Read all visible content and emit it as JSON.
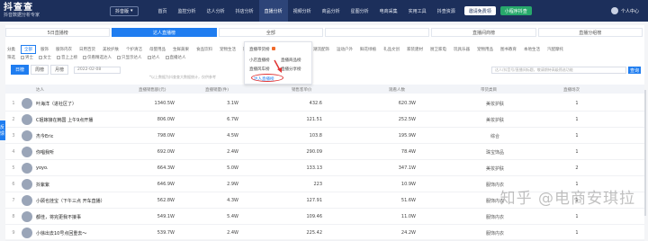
{
  "topbar": {
    "logo_main": "抖查查",
    "logo_sub": "抖音数据分析专家",
    "platform": "抖音版",
    "nav": [
      "首页",
      "监控分析",
      "达人分析",
      "抖店分析",
      "直播分析",
      "视频分析",
      "商品分析",
      "星图分析",
      "电商采集",
      "实用工具",
      "抖查资源"
    ],
    "vip_btn": "邀请免费领",
    "app_btn": "小程序抖查",
    "user": "个人中心"
  },
  "tabs": [
    "5日直播榜",
    "达人直播榜",
    "全部",
    "",
    "直播间商榜",
    "直播分组榜"
  ],
  "categories": {
    "label": "分类",
    "items": [
      "全部",
      "服饰",
      "服饰内衣",
      "日用百货",
      "美妆护肤",
      "个护清洁",
      "母婴用品",
      "生鲜蔬果",
      "食品饮料",
      "宠物生活",
      "影音娱乐",
      "智能家居",
      "家纺家具",
      "潮流配饰",
      "运动户外",
      "鲜花绿植",
      "礼品文创",
      "家装建材",
      "厨卫家电",
      "玩具乐器",
      "宠物用品",
      "图书教育",
      "本地生活",
      "汽配摩托"
    ]
  },
  "filters": {
    "label": "筛选",
    "items": [
      "男士",
      "女士",
      "音上上榜",
      "仅看精选达人",
      "只显示达人",
      "达人",
      "直播达人"
    ]
  },
  "date": {
    "segments": [
      "日榜",
      "周榜",
      "月榜"
    ],
    "value": "2022-02-08"
  },
  "search": {
    "placeholder": "达人/抖音号/直播间标题，敬请期待高级筛选功能",
    "btn": "查询"
  },
  "note": "*以上数据为抖查查大数据统计，仅供参考",
  "headers": [
    "达人",
    "直播销售额(元)",
    "直播销量(件)",
    "销售客单价",
    "观看人数",
    "带货类目",
    "直播场次"
  ],
  "rows": [
    {
      "rank": "1",
      "name": "叶海洋（进社区了）",
      "sales": "1340.5W",
      "volume": "3.1W",
      "price": "432.6",
      "views": "620.3W",
      "category": "美妆护肤",
      "count": "1"
    },
    {
      "rank": "2",
      "name": "C姐嫁接在韩国 上午9点开播",
      "sales": "806.0W",
      "volume": "6.7W",
      "price": "121.51",
      "views": "252.5W",
      "category": "美妆护肤",
      "count": "1"
    },
    {
      "rank": "3",
      "name": "杰今Eric",
      "sales": "798.0W",
      "volume": "4.5W",
      "price": "103.8",
      "views": "195.9W",
      "category": "综合",
      "count": "1"
    },
    {
      "rank": "4",
      "name": "你唱我听",
      "sales": "692.0W",
      "volume": "2.4W",
      "price": "290.09",
      "views": "78.4W",
      "category": "珠宝饰品",
      "count": "1"
    },
    {
      "rank": "5",
      "name": "yoyo.",
      "sales": "664.3W",
      "volume": "5.0W",
      "price": "133.13",
      "views": "347.1W",
      "category": "美妆护肤",
      "count": "2"
    },
    {
      "rank": "6",
      "name": "抖紫紫",
      "sales": "646.9W",
      "volume": "2.9W",
      "price": "223",
      "views": "10.9W",
      "category": "服饰内衣",
      "count": "1"
    },
    {
      "rank": "7",
      "name": "小顾也挂宝（下午三点 开车直播）",
      "sales": "562.8W",
      "volume": "4.3W",
      "price": "127.91",
      "views": "51.6W",
      "category": "服饰内衣",
      "count": "1"
    },
    {
      "rank": "8",
      "name": "都佳，将完更我不接事",
      "sales": "549.1W",
      "volume": "5.4W",
      "price": "109.46",
      "views": "11.0W",
      "category": "服饰内衣",
      "count": "1"
    },
    {
      "rank": "9",
      "name": "小徐出去10号点回重去～",
      "sales": "539.7W",
      "volume": "2.4W",
      "price": "225.42",
      "views": "24.2W",
      "category": "服饰内衣",
      "count": "1"
    }
  ],
  "dropdown": {
    "items": [
      "直播带货榜",
      "小店直播榜",
      "直播商品榜",
      "直播风车榜",
      "直播分享榜",
      "达人直播榜"
    ]
  },
  "side_tab": "反馈",
  "watermark": "知乎 @电商安琪拉",
  "colors": {
    "accent": "#1f7df0",
    "nav_bg": "#1c2f5b",
    "highlight": "#e03333"
  }
}
